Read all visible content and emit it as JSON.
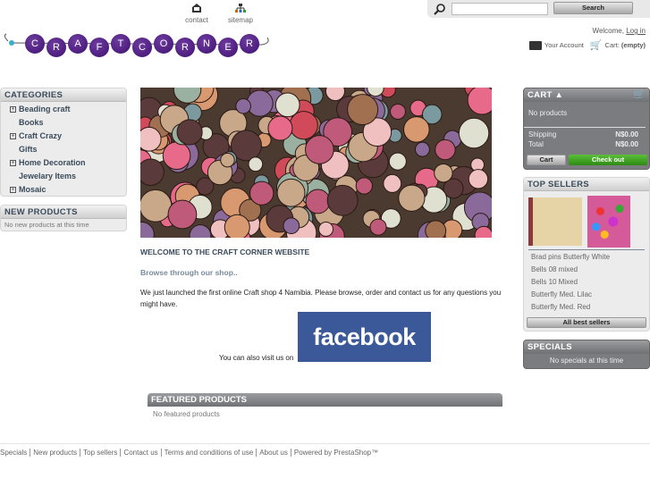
{
  "header": {
    "links": [
      {
        "label": "contact",
        "icon": "contact-icon"
      },
      {
        "label": "sitemap",
        "icon": "sitemap-icon"
      }
    ],
    "search": {
      "placeholder": "",
      "value": "",
      "button": "Search"
    },
    "welcome": "Welcome,",
    "login": "Log in",
    "account": "Your Account",
    "cart_label": "Cart:",
    "cart_status": "(empty)",
    "logo_letters": [
      "C",
      "R",
      "A",
      "F",
      "T",
      "C",
      "O",
      "R",
      "N",
      "E",
      "R"
    ],
    "logo_text": "CRAFTCORNER"
  },
  "left": {
    "categories_title": "CATEGORIES",
    "categories": [
      {
        "label": "Beading craft",
        "expandable": true
      },
      {
        "label": "Books",
        "expandable": false
      },
      {
        "label": "Craft Crazy",
        "expandable": true
      },
      {
        "label": "Gifts",
        "expandable": false
      },
      {
        "label": "Home Decoration",
        "expandable": true
      },
      {
        "label": "Jewelary Items",
        "expandable": false
      },
      {
        "label": "Mosaic",
        "expandable": true
      }
    ],
    "new_title": "NEW PRODUCTS",
    "new_empty": "No new products at this time"
  },
  "main": {
    "welcome_title": "WELCOME TO THE CRAFT CORNER WEBSITE",
    "browse": "Browse through our shop..",
    "intro": "We just launched the first online Craft shop 4 Namibia.  Please browse, order and contact us for any questions you might have.",
    "visit": "You can also visit us on",
    "facebook": "facebook",
    "featured_title": "FEATURED PRODUCTS",
    "featured_empty": "No featured products"
  },
  "right": {
    "cart_title": "CART",
    "cart_empty": "No products",
    "shipping_label": "Shipping",
    "shipping_value": "N$0.00",
    "total_label": "Total",
    "total_value": "N$0.00",
    "cart_button": "Cart",
    "checkout_button": "Check out",
    "top_title": "TOP SELLERS",
    "top_items": [
      "Brad pins Butterfly White",
      "Bells 08 mixed",
      "Bells 10 Mixed",
      "Butterfly Med. Lilac",
      "Butterfly Med. Red"
    ],
    "all_best": "All best sellers",
    "specials_title": "SPECIALS",
    "specials_empty": "No specials at this time"
  },
  "footer": [
    "Specials",
    "New products",
    "Top sellers",
    "Contact us",
    "Terms and conditions of use",
    "About us",
    "Powered by PrestaShop™"
  ],
  "colors": {
    "brand_purple": "#4b1a78",
    "checkout_green": "#3a9a1e",
    "facebook_blue": "#3b5998",
    "box_dark": "#7a7c80"
  }
}
